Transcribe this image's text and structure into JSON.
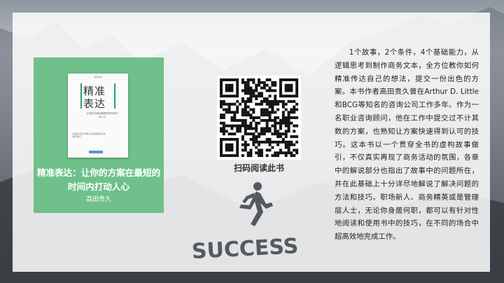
{
  "book": {
    "cover_title_line1": "精准",
    "cover_title_line2": "表达",
    "cover_publisher": "湛庐文化",
    "cover_subtitle": "让你的方案在最短的时间内打动人心",
    "cover_blurb": "全面提升商务写作能力 快速掌握商务文本的撰写技巧",
    "title": "精准表达：让你的方案在最短的时间内打动人心",
    "author": "高田贵久"
  },
  "qr": {
    "label": "扫码阅读此书"
  },
  "badge": {
    "text": "SUCCESS"
  },
  "description": "1个故事，2个条件，4个基础能力，从逻辑思考到制作商务文本，全方位教你如何精准传达自己的想法，提交一份出色的方案。本书作者高田贵久曾在Arthur D. Little和BCG等知名的咨询公司工作多年。作为一名职业咨询顾问，他在工作中提交过不计其数的方案，也熟知让方案快速得到认可的技巧。这本书以一个贯穿全书的虚构故事做引，不仅真实再现了商务活动的氛围，各章中的解说部分也指出了故事中的问题所在，并在此基础上十分详尽地解说了解决问题的方法和技巧。职场新人、商务精英或是管理层人士，无论你身居何职，都可以有针对性地阅读和使用书中的技巧，在不同的场合中超高效地完成工作。",
  "colors": {
    "card": "#6fc08a",
    "accent_green": "#2aa06f",
    "success_gray": "#555a5f"
  }
}
